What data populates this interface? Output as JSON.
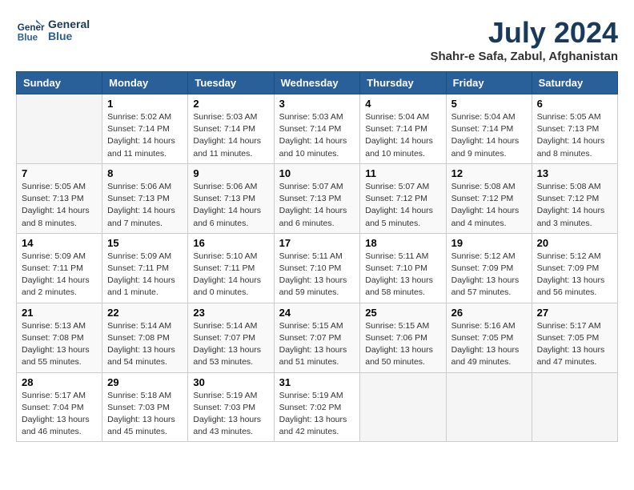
{
  "logo": {
    "text_general": "General",
    "text_blue": "Blue"
  },
  "title": "July 2024",
  "subtitle": "Shahr-e Safa, Zabul, Afghanistan",
  "headers": [
    "Sunday",
    "Monday",
    "Tuesday",
    "Wednesday",
    "Thursday",
    "Friday",
    "Saturday"
  ],
  "weeks": [
    [
      {
        "day": "",
        "sunrise": "",
        "sunset": "",
        "daylight": ""
      },
      {
        "day": "1",
        "sunrise": "Sunrise: 5:02 AM",
        "sunset": "Sunset: 7:14 PM",
        "daylight": "Daylight: 14 hours and 11 minutes."
      },
      {
        "day": "2",
        "sunrise": "Sunrise: 5:03 AM",
        "sunset": "Sunset: 7:14 PM",
        "daylight": "Daylight: 14 hours and 11 minutes."
      },
      {
        "day": "3",
        "sunrise": "Sunrise: 5:03 AM",
        "sunset": "Sunset: 7:14 PM",
        "daylight": "Daylight: 14 hours and 10 minutes."
      },
      {
        "day": "4",
        "sunrise": "Sunrise: 5:04 AM",
        "sunset": "Sunset: 7:14 PM",
        "daylight": "Daylight: 14 hours and 10 minutes."
      },
      {
        "day": "5",
        "sunrise": "Sunrise: 5:04 AM",
        "sunset": "Sunset: 7:14 PM",
        "daylight": "Daylight: 14 hours and 9 minutes."
      },
      {
        "day": "6",
        "sunrise": "Sunrise: 5:05 AM",
        "sunset": "Sunset: 7:13 PM",
        "daylight": "Daylight: 14 hours and 8 minutes."
      }
    ],
    [
      {
        "day": "7",
        "sunrise": "Sunrise: 5:05 AM",
        "sunset": "Sunset: 7:13 PM",
        "daylight": "Daylight: 14 hours and 8 minutes."
      },
      {
        "day": "8",
        "sunrise": "Sunrise: 5:06 AM",
        "sunset": "Sunset: 7:13 PM",
        "daylight": "Daylight: 14 hours and 7 minutes."
      },
      {
        "day": "9",
        "sunrise": "Sunrise: 5:06 AM",
        "sunset": "Sunset: 7:13 PM",
        "daylight": "Daylight: 14 hours and 6 minutes."
      },
      {
        "day": "10",
        "sunrise": "Sunrise: 5:07 AM",
        "sunset": "Sunset: 7:13 PM",
        "daylight": "Daylight: 14 hours and 6 minutes."
      },
      {
        "day": "11",
        "sunrise": "Sunrise: 5:07 AM",
        "sunset": "Sunset: 7:12 PM",
        "daylight": "Daylight: 14 hours and 5 minutes."
      },
      {
        "day": "12",
        "sunrise": "Sunrise: 5:08 AM",
        "sunset": "Sunset: 7:12 PM",
        "daylight": "Daylight: 14 hours and 4 minutes."
      },
      {
        "day": "13",
        "sunrise": "Sunrise: 5:08 AM",
        "sunset": "Sunset: 7:12 PM",
        "daylight": "Daylight: 14 hours and 3 minutes."
      }
    ],
    [
      {
        "day": "14",
        "sunrise": "Sunrise: 5:09 AM",
        "sunset": "Sunset: 7:11 PM",
        "daylight": "Daylight: 14 hours and 2 minutes."
      },
      {
        "day": "15",
        "sunrise": "Sunrise: 5:09 AM",
        "sunset": "Sunset: 7:11 PM",
        "daylight": "Daylight: 14 hours and 1 minute."
      },
      {
        "day": "16",
        "sunrise": "Sunrise: 5:10 AM",
        "sunset": "Sunset: 7:11 PM",
        "daylight": "Daylight: 14 hours and 0 minutes."
      },
      {
        "day": "17",
        "sunrise": "Sunrise: 5:11 AM",
        "sunset": "Sunset: 7:10 PM",
        "daylight": "Daylight: 13 hours and 59 minutes."
      },
      {
        "day": "18",
        "sunrise": "Sunrise: 5:11 AM",
        "sunset": "Sunset: 7:10 PM",
        "daylight": "Daylight: 13 hours and 58 minutes."
      },
      {
        "day": "19",
        "sunrise": "Sunrise: 5:12 AM",
        "sunset": "Sunset: 7:09 PM",
        "daylight": "Daylight: 13 hours and 57 minutes."
      },
      {
        "day": "20",
        "sunrise": "Sunrise: 5:12 AM",
        "sunset": "Sunset: 7:09 PM",
        "daylight": "Daylight: 13 hours and 56 minutes."
      }
    ],
    [
      {
        "day": "21",
        "sunrise": "Sunrise: 5:13 AM",
        "sunset": "Sunset: 7:08 PM",
        "daylight": "Daylight: 13 hours and 55 minutes."
      },
      {
        "day": "22",
        "sunrise": "Sunrise: 5:14 AM",
        "sunset": "Sunset: 7:08 PM",
        "daylight": "Daylight: 13 hours and 54 minutes."
      },
      {
        "day": "23",
        "sunrise": "Sunrise: 5:14 AM",
        "sunset": "Sunset: 7:07 PM",
        "daylight": "Daylight: 13 hours and 53 minutes."
      },
      {
        "day": "24",
        "sunrise": "Sunrise: 5:15 AM",
        "sunset": "Sunset: 7:07 PM",
        "daylight": "Daylight: 13 hours and 51 minutes."
      },
      {
        "day": "25",
        "sunrise": "Sunrise: 5:15 AM",
        "sunset": "Sunset: 7:06 PM",
        "daylight": "Daylight: 13 hours and 50 minutes."
      },
      {
        "day": "26",
        "sunrise": "Sunrise: 5:16 AM",
        "sunset": "Sunset: 7:05 PM",
        "daylight": "Daylight: 13 hours and 49 minutes."
      },
      {
        "day": "27",
        "sunrise": "Sunrise: 5:17 AM",
        "sunset": "Sunset: 7:05 PM",
        "daylight": "Daylight: 13 hours and 47 minutes."
      }
    ],
    [
      {
        "day": "28",
        "sunrise": "Sunrise: 5:17 AM",
        "sunset": "Sunset: 7:04 PM",
        "daylight": "Daylight: 13 hours and 46 minutes."
      },
      {
        "day": "29",
        "sunrise": "Sunrise: 5:18 AM",
        "sunset": "Sunset: 7:03 PM",
        "daylight": "Daylight: 13 hours and 45 minutes."
      },
      {
        "day": "30",
        "sunrise": "Sunrise: 5:19 AM",
        "sunset": "Sunset: 7:03 PM",
        "daylight": "Daylight: 13 hours and 43 minutes."
      },
      {
        "day": "31",
        "sunrise": "Sunrise: 5:19 AM",
        "sunset": "Sunset: 7:02 PM",
        "daylight": "Daylight: 13 hours and 42 minutes."
      },
      {
        "day": "",
        "sunrise": "",
        "sunset": "",
        "daylight": ""
      },
      {
        "day": "",
        "sunrise": "",
        "sunset": "",
        "daylight": ""
      },
      {
        "day": "",
        "sunrise": "",
        "sunset": "",
        "daylight": ""
      }
    ]
  ]
}
